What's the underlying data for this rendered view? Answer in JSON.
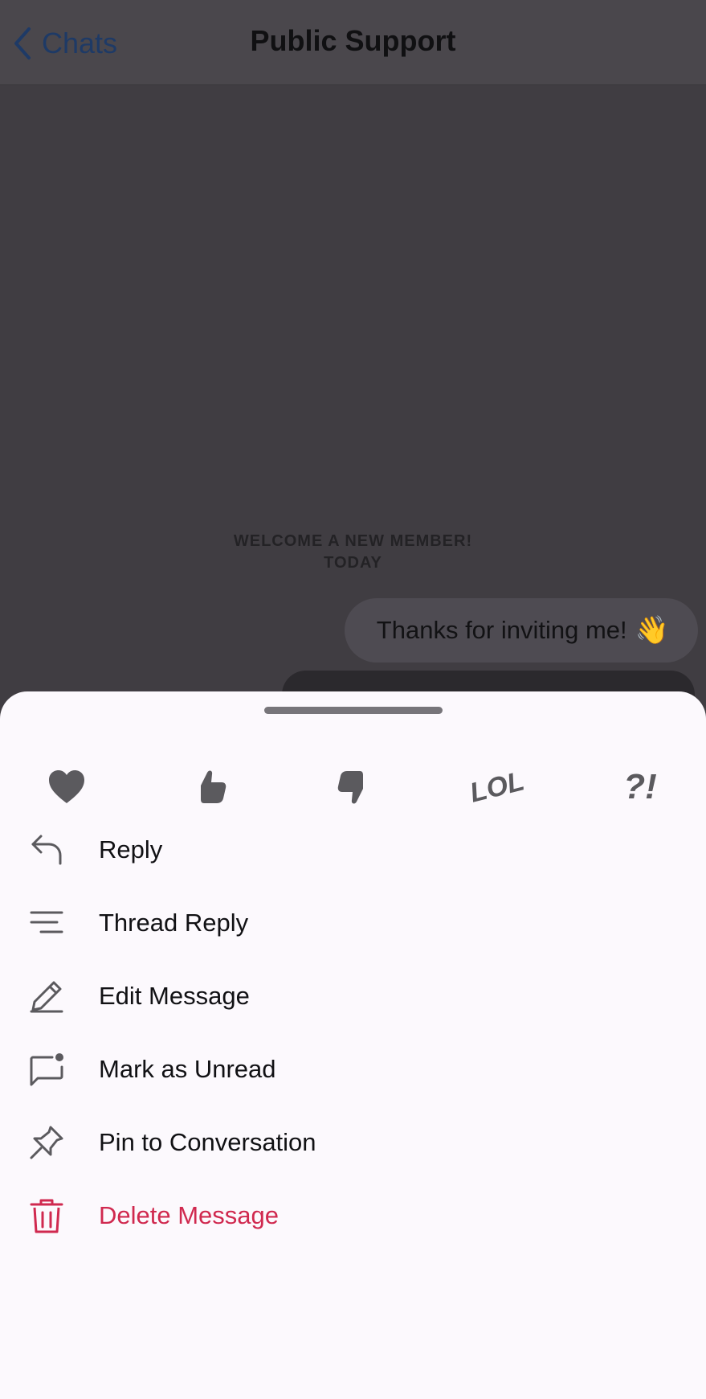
{
  "nav": {
    "back_label": "Chats",
    "title": "Public Support"
  },
  "chat": {
    "system_message_line1": "WELCOME A NEW MEMBER!",
    "system_message_line2": "TODAY",
    "bubble_text": "Thanks for inviting me!",
    "bubble_emoji": "👋"
  },
  "reactions": [
    {
      "name": "heart-icon"
    },
    {
      "name": "thumbs-up-icon"
    },
    {
      "name": "thumbs-down-icon"
    },
    {
      "name": "lol-icon",
      "text": "LOL"
    },
    {
      "name": "wut-icon",
      "text": "?!"
    }
  ],
  "menu": {
    "reply": "Reply",
    "thread_reply": "Thread Reply",
    "edit_message": "Edit Message",
    "mark_unread": "Mark as Unread",
    "pin": "Pin to Conversation",
    "delete": "Delete Message"
  },
  "colors": {
    "danger": "#d0294f",
    "icon": "#5b5a5e",
    "sheet_bg": "#fcf9fd"
  }
}
